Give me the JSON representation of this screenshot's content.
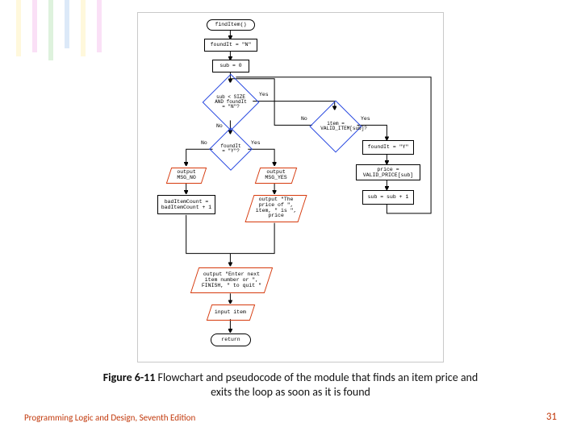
{
  "caption": {
    "figure_label": "Figure 6-11",
    "text_line1": " Flowchart and pseudocode of the module that finds an item price and",
    "text_line2": "exits the loop as soon as it is found"
  },
  "footer": {
    "left": "Programming Logic and Design, Seventh Edition",
    "page_number": "31"
  },
  "flow": {
    "start": "findItem()",
    "init_found": "foundIt = \"N\"",
    "init_sub": "sub = 0",
    "loop_cond": "sub < SIZE AND\nfoundIt = \"N\"?",
    "loop_yes": "Yes",
    "loop_no_left": "No",
    "item_cond": "item =\nVALID_ITEM[sub]?",
    "item_no": "No",
    "item_yes": "Yes",
    "set_found": "foundIt = \"Y\"",
    "set_price": "price =\nVALID_PRICE[sub]",
    "incr_sub": "sub = sub + 1",
    "found_check": "foundIt\n= \"Y\"?",
    "found_no": "No",
    "found_yes": "Yes",
    "out_no": "output\nMSG_NO",
    "out_yes": "output\nMSG_YES",
    "bad_count": "badItemCount =\nbadItemCount + 1",
    "out_price": "output \"The\nprice of \", item,\n\" is \", price",
    "out_prompt": "output \"Enter next item\nnumber or \", FINISH,\n\" to quit \"",
    "input_item": "input item",
    "return": "return"
  }
}
